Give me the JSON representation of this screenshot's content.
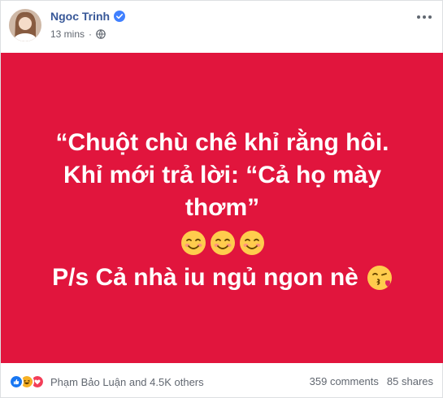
{
  "post": {
    "author_name": "Ngoc Trinh",
    "timestamp": "13 mins",
    "separator": "·",
    "verified_icon": "verified-badge-icon",
    "privacy_icon": "globe-icon",
    "more_icon": "more-horizontal-icon"
  },
  "status": {
    "background_color": "#e1153d",
    "text_color": "#ffffff",
    "line1": "“Chuột chù chê khỉ rằng hôi.",
    "line2": "Khỉ mới trả lời: “Cả họ mày",
    "line3": "thơm”",
    "smile_emojis": [
      "smiling-face-icon",
      "smiling-face-icon",
      "smiling-face-icon"
    ],
    "line4": "P/s Cả nhà iu ngủ ngon nè",
    "kiss_emoji": "face-blowing-kiss-icon"
  },
  "footer": {
    "reaction_icons": [
      "like-icon",
      "haha-icon",
      "love-icon"
    ],
    "reactions_text": "Phạm Bảo Luận and 4.5K others",
    "comments": "359 comments",
    "shares": "85 shares"
  }
}
